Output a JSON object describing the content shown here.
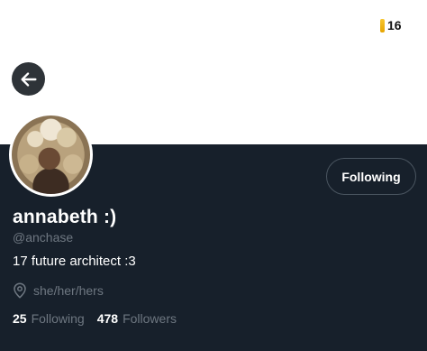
{
  "status": {
    "badge_count": "16"
  },
  "header": {
    "back_icon": "arrow-left-icon"
  },
  "profile": {
    "display_name": "annabeth :)",
    "handle": "@anchase",
    "bio": "17 future architect :3",
    "location": "she/her/hers",
    "location_icon": "location-pin-icon",
    "follow_button_label": "Following",
    "stats": {
      "following_count": "25",
      "following_label": "Following",
      "followers_count": "478",
      "followers_label": "Followers"
    }
  },
  "colors": {
    "profile_background": "#17202b",
    "secondary_text": "#6e7781",
    "badge_accent": "#f2b705"
  }
}
